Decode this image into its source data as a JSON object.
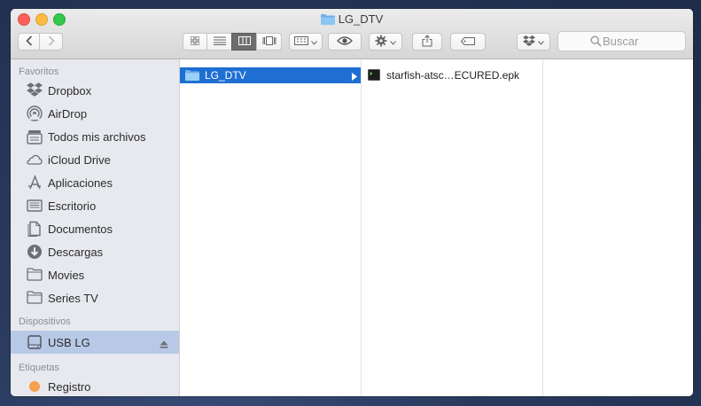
{
  "window": {
    "title": "LG_DTV"
  },
  "toolbar": {
    "search_placeholder": "Buscar",
    "buttons": [
      "back",
      "forward",
      "icon-view",
      "list-view",
      "column-view",
      "cover-flow-view",
      "arrange",
      "quick-look",
      "action",
      "share",
      "tags",
      "dropbox"
    ]
  },
  "sidebar": {
    "sections": [
      {
        "title": "Favoritos",
        "items": [
          {
            "label": "Dropbox",
            "icon": "dropbox-icon"
          },
          {
            "label": "AirDrop",
            "icon": "airdrop-icon"
          },
          {
            "label": "Todos mis archivos",
            "icon": "all-files-icon"
          },
          {
            "label": "iCloud Drive",
            "icon": "cloud-icon"
          },
          {
            "label": "Aplicaciones",
            "icon": "applications-icon"
          },
          {
            "label": "Escritorio",
            "icon": "desktop-icon"
          },
          {
            "label": "Documentos",
            "icon": "documents-icon"
          },
          {
            "label": "Descargas",
            "icon": "downloads-icon"
          },
          {
            "label": "Movies",
            "icon": "folder-icon"
          },
          {
            "label": "Series TV",
            "icon": "folder-icon"
          }
        ]
      },
      {
        "title": "Dispositivos",
        "items": [
          {
            "label": "USB LG",
            "icon": "drive-icon",
            "selected": true
          }
        ]
      },
      {
        "title": "Etiquetas",
        "items": [
          {
            "label": "Registro",
            "icon": "tag-orange-icon"
          }
        ]
      }
    ]
  },
  "columns": [
    {
      "items": [
        {
          "name": "LG_DTV",
          "type": "folder",
          "selected": true
        }
      ]
    },
    {
      "items": [
        {
          "name": "starfish-atsc…ECURED.epk",
          "type": "file"
        }
      ]
    },
    {
      "items": []
    }
  ],
  "colors": {
    "selection": "#1f6fd3",
    "sidebar_bg": "#e7e9ee",
    "sidebar_selected": "#b8c9e7"
  }
}
